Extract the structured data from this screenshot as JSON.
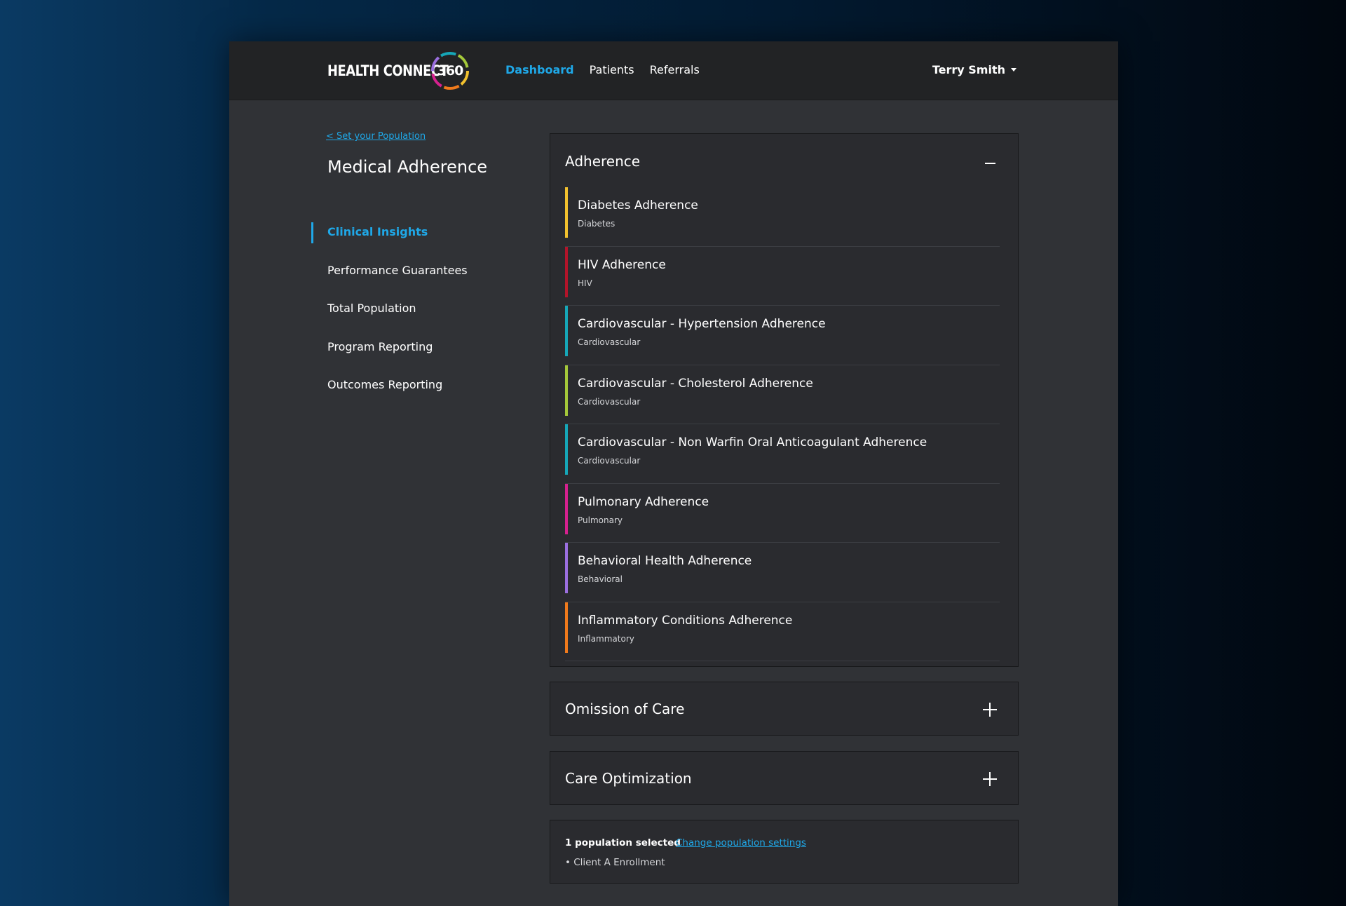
{
  "header": {
    "logo_text": "HEALTH CONNECT",
    "logo_number": "360",
    "nav": [
      {
        "label": "Dashboard",
        "active": true
      },
      {
        "label": "Patients",
        "active": false
      },
      {
        "label": "Referrals",
        "active": false
      }
    ],
    "user_name": "Terry Smith"
  },
  "sidebar": {
    "back_link": "< Set your Population",
    "page_title": "Medical Adherence",
    "items": [
      {
        "label": "Clinical Insights",
        "active": true
      },
      {
        "label": "Performance Guarantees",
        "active": false
      },
      {
        "label": "Total Population",
        "active": false
      },
      {
        "label": "Program Reporting",
        "active": false
      },
      {
        "label": "Outcomes Reporting",
        "active": false
      }
    ]
  },
  "adherence": {
    "title": "Adherence",
    "expanded": true,
    "items": [
      {
        "title": "Diabetes Adherence",
        "category": "Diabetes",
        "color": "#f2c12e"
      },
      {
        "title": "HIV Adherence",
        "category": "HIV",
        "color": "#b3142a"
      },
      {
        "title": "Cardiovascular - Hypertension Adherence",
        "category": "Cardiovascular",
        "color": "#16a7b8"
      },
      {
        "title": "Cardiovascular - Cholesterol Adherence",
        "category": "Cardiovascular",
        "color": "#a4c83a"
      },
      {
        "title": "Cardiovascular - Non Warfin Oral Anticoagulant Adherence",
        "category": "Cardiovascular",
        "color": "#16a7b8"
      },
      {
        "title": "Pulmonary Adherence",
        "category": "Pulmonary",
        "color": "#d6218f"
      },
      {
        "title": "Behavioral Health Adherence",
        "category": "Behavioral",
        "color": "#9b6fe0"
      },
      {
        "title": "Inflammatory Conditions Adherence",
        "category": "Inflammatory",
        "color": "#f07a1c"
      }
    ]
  },
  "omission_of_care": {
    "title": "Omission of Care",
    "expanded": false
  },
  "care_optimization": {
    "title": "Care Optimization",
    "expanded": false
  },
  "population": {
    "count_text": "1 population selected",
    "change_link": "Change population settings",
    "items": [
      "• Client A Enrollment"
    ]
  },
  "colors": {
    "accent": "#1fa8e8",
    "logo_ring": [
      "#f2c12e",
      "#f07a1c",
      "#d6218f",
      "#9b6fe0",
      "#16a7b8",
      "#a4c83a"
    ]
  }
}
